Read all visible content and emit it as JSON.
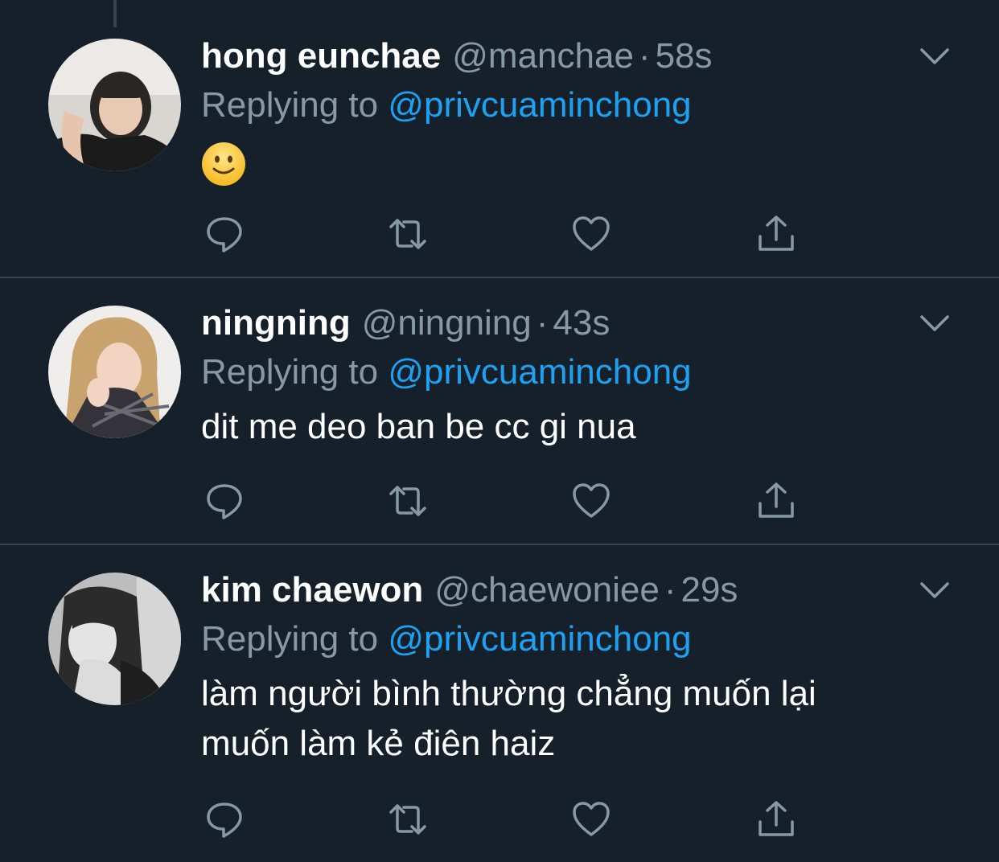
{
  "reply_prefix": "Replying to ",
  "tweets": [
    {
      "name": "hong eunchae",
      "handle": "@manchae",
      "separator": "·",
      "time": "58s",
      "replying_to": "@privcuaminchong",
      "text": "",
      "emoji": "slightly-smiling-face"
    },
    {
      "name": "ningning",
      "handle": "@ningning",
      "separator": "·",
      "time": "43s",
      "replying_to": "@privcuaminchong",
      "text": "dit me deo ban be cc gi nua"
    },
    {
      "name": "kim chaewon",
      "handle": "@chaewoniee",
      "separator": "·",
      "time": "29s",
      "replying_to": "@privcuaminchong",
      "text_line1": "làm người bình thường chẳng muốn lại",
      "text_line2": "muốn làm kẻ điên haiz"
    }
  ],
  "icons": {
    "reply": "reply-icon",
    "retweet": "retweet-icon",
    "like": "heart-icon",
    "share": "share-icon",
    "more": "chevron-down-icon"
  },
  "colors": {
    "background": "#15202b",
    "divider": "#38444d",
    "secondary_text": "#8899a6",
    "mention": "#1da1f2"
  }
}
